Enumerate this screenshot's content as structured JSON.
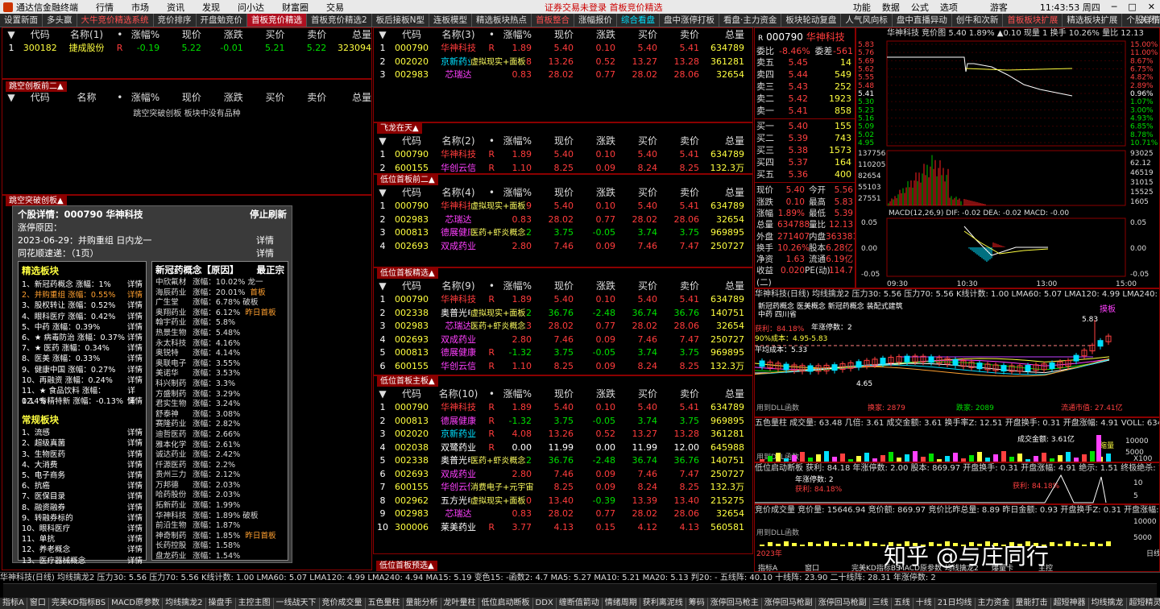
{
  "menubar": {
    "title": "通达信金融终端",
    "items": [
      "行情",
      "市场",
      "资讯",
      "发现",
      "问小达",
      "财富圈",
      "交易"
    ],
    "center": "证券交易未登录  首板竞价精选",
    "right": [
      "功能",
      "数据",
      "公式",
      "选项",
      "游客",
      "11:43:53 周四",
      "─",
      "□",
      "✕"
    ]
  },
  "tabs": [
    {
      "label": "设置新面",
      "k": ""
    },
    {
      "label": "多头赢",
      "k": ""
    },
    {
      "label": "大牛竞价精选系统",
      "k": "hot"
    },
    {
      "label": "竞价排序",
      "k": ""
    },
    {
      "label": "开盘勉竞价",
      "k": ""
    },
    {
      "label": "首板竞价精选",
      "k": "act"
    },
    {
      "label": "首板竞价精选2",
      "k": ""
    },
    {
      "label": "板后接板N型",
      "k": ""
    },
    {
      "label": "连板模型",
      "k": ""
    },
    {
      "label": "精选板块热点",
      "k": ""
    },
    {
      "label": "首板整合",
      "k": "hot"
    },
    {
      "label": "涨幅报价",
      "k": ""
    },
    {
      "label": "综合看盘",
      "k": "cy"
    },
    {
      "label": "盘中涨停打板",
      "k": ""
    },
    {
      "label": "看盘·主力资金",
      "k": ""
    },
    {
      "label": "板块轮动复盘",
      "k": ""
    },
    {
      "label": "人气风向标",
      "k": ""
    },
    {
      "label": "盘中直播异动",
      "k": ""
    },
    {
      "label": "创牛和次新",
      "k": ""
    },
    {
      "label": "首板板块扩展",
      "k": "hot"
    },
    {
      "label": "精选板块扩展",
      "k": ""
    },
    {
      "label": "个股详情",
      "k": ""
    }
  ],
  "left_top": {
    "headers": [
      "▼",
      "代码",
      "名称(1)",
      "•",
      "涨幅%",
      "现价",
      "涨跌",
      "买价",
      "卖价",
      "总量"
    ],
    "rows": [
      [
        "1",
        "300182",
        "捷成股份",
        "R",
        "-0.19",
        "5.22",
        "-0.01",
        "5.21",
        "5.22",
        "323094"
      ]
    ]
  },
  "left_mid": {
    "badge": "跳空创板前二▲",
    "headers": [
      "▼",
      "代码",
      "名称",
      "•",
      "涨幅%",
      "现价",
      "涨跌",
      "买价",
      "卖价",
      "总量"
    ],
    "empty": "跳空突破创板 板块中没有品种"
  },
  "left_bottom_badge": "跳空突破创板▲",
  "detail": {
    "title": "个股详情：000790  华神科技",
    "refresh": "停止刷新",
    "reason": "涨停原因：",
    "date": "2023-06-29：并购重组  日内龙一",
    "detail": "详情",
    "speed": "同花顺速递：（1页）",
    "speed_detail": "详情"
  },
  "select": {
    "title": "精选板块",
    "items": [
      [
        "1、新冠药概念 涨幅：1%",
        "详情"
      ],
      [
        "2、并购重组 涨幅：0.55%",
        "详情"
      ],
      [
        "3、股权转让 涨幅：0.52%",
        "详情"
      ],
      [
        "4、眼科医疗 涨幅：0.42%",
        "详情"
      ],
      [
        "5、中药 涨幅：0.39%",
        "详情"
      ],
      [
        "6、★ 病毒防治 涨幅：0.37%",
        "详情"
      ],
      [
        "7、★ 医药 涨幅：0.34%",
        "详情"
      ],
      [
        "8、医美 涨幅：0.33%",
        "详情"
      ],
      [
        "9、健康中国 涨幅：0.27%",
        "详情"
      ],
      [
        "10、再融资 涨幅：0.24%",
        "详情"
      ],
      [
        "11、★ 食品饮料 涨幅：0.14%",
        "详情"
      ],
      [
        "12、专精特新 涨幅：-0.13%",
        "详情"
      ]
    ],
    "normal_title": "常规板块",
    "normal": [
      [
        "1、流感",
        "详情"
      ],
      [
        "2、超级真菌",
        "详情"
      ],
      [
        "3、生物医药",
        "详情"
      ],
      [
        "4、大消费",
        "详情"
      ],
      [
        "5、电子商务",
        "详情"
      ],
      [
        "6、抗癌",
        "详情"
      ],
      [
        "7、医保目录",
        "详情"
      ],
      [
        "8、融资融券",
        "详情"
      ],
      [
        "9、转融券标的",
        "详情"
      ],
      [
        "10、眼科医疗",
        "详情"
      ],
      [
        "11、单抗",
        "详情"
      ],
      [
        "12、养老概念",
        "详情"
      ],
      [
        "13、医疗器械概念",
        "详情"
      ]
    ]
  },
  "concept": {
    "title": "新冠药概念【原因】",
    "lead": "最正宗",
    "rows": [
      [
        "中欣氟材",
        "涨幅：10.02% 龙一"
      ],
      [
        "海辰药业",
        "涨幅：20.01%",
        "首板"
      ],
      [
        "广生堂",
        "涨幅：6.78% 破板"
      ],
      [
        "奥翔药业",
        "涨幅：6.12%",
        "昨日首板"
      ],
      [
        "翰宇药业",
        "涨幅：5.8%"
      ],
      [
        "热景生物",
        "涨幅：5.48%"
      ],
      [
        "永太科技",
        "涨幅：4.16%"
      ],
      [
        "奥锐特",
        "涨幅：4.14%"
      ],
      [
        "奥联电子",
        "涨幅：3.55%"
      ],
      [
        "美诺华",
        "涨幅：3.53%"
      ],
      [
        "科兴制药",
        "涨幅：3.3%"
      ],
      [
        "方盛制药",
        "涨幅：3.29%"
      ],
      [
        "君实生物",
        "涨幅：3.24%"
      ],
      [
        "舒泰神",
        "涨幅：3.08%"
      ],
      [
        "赛隆药业",
        "涨幅：2.82%"
      ],
      [
        "迪哲医药",
        "涨幅：2.66%"
      ],
      [
        "雅本化学",
        "涨幅：2.61%"
      ],
      [
        "诚达药业",
        "涨幅：2.42%"
      ],
      [
        "仟源医药",
        "涨幅：2.2%"
      ],
      [
        "贵州三力",
        "涨幅：2.12%"
      ],
      [
        "万邦德",
        "涨幅：2.03%"
      ],
      [
        "哈药股份",
        "涨幅：2.03%"
      ],
      [
        "拓新药业",
        "涨幅：1.99%"
      ],
      [
        "华神科技",
        "涨幅：1.89% 破板"
      ],
      [
        "前沿生物",
        "涨幅：1.87%"
      ],
      [
        "神奇制药",
        "涨幅：1.85%",
        "昨日首板"
      ],
      [
        "长药控股",
        "涨幅：1.58%"
      ],
      [
        "盘龙药业",
        "涨幅：1.54%"
      ]
    ]
  },
  "mid_headers": [
    "▼",
    "代码",
    "名称",
    "•",
    "涨幅%",
    "现价",
    "涨跌",
    "买价",
    "卖价",
    "总量"
  ],
  "mid_panels": [
    {
      "badge": "",
      "hname": "名称(3)",
      "rows": [
        [
          "1",
          "000790",
          "华神科技",
          "R",
          "1.89",
          "5.40",
          "0.10",
          "5.40",
          "5.41",
          "634789",
          "r"
        ],
        [
          "2",
          "002020",
          "京新药业",
          "R",
          "4.08",
          "13.26",
          "0.52",
          "13.27",
          "13.28",
          "361281",
          "b"
        ],
        [
          "3",
          "002983",
          "芯瑞达",
          "",
          "0.83",
          "28.02",
          "0.77",
          "28.02",
          "28.06",
          "32654",
          "m"
        ]
      ],
      "notes": [
        [
          "虚拟现实+面板",
          2
        ]
      ]
    },
    {
      "badge": "飞龙在天▲",
      "hname": "名称(2)",
      "rows": [
        [
          "1",
          "000790",
          "华神科技",
          "R",
          "1.89",
          "5.40",
          "0.10",
          "5.40",
          "5.41",
          "634789",
          "r"
        ],
        [
          "2",
          "600155",
          "华创云信",
          "R",
          "1.10",
          "8.25",
          "0.09",
          "8.24",
          "8.25",
          "132.3万",
          "m"
        ]
      ],
      "notes": []
    },
    {
      "badge": "低位首板前二▲",
      "hname": "名称(4)",
      "rows": [
        [
          "1",
          "000790",
          "华神科技",
          "R",
          "1.89",
          "5.40",
          "0.10",
          "5.40",
          "5.41",
          "634789",
          "r"
        ],
        [
          "2",
          "002983",
          "芯瑞达",
          "",
          "0.83",
          "28.02",
          "0.77",
          "28.02",
          "28.06",
          "32654",
          "m"
        ],
        [
          "3",
          "000813",
          "德展健康",
          "R",
          "-1.32",
          "3.75",
          "-0.05",
          "3.74",
          "3.75",
          "969895",
          "m"
        ],
        [
          "4",
          "002693",
          "双成药业",
          "",
          "2.80",
          "7.46",
          "0.09",
          "7.46",
          "7.47",
          "250727",
          "m"
        ]
      ],
      "notes": [
        [
          "虚拟现实+面板",
          1
        ],
        [
          "医药+虾炎概念",
          3
        ]
      ]
    },
    {
      "badge": "低位首板精选▲",
      "hname": "名称(9)",
      "rows": [
        [
          "1",
          "000790",
          "华神科技",
          "R",
          "1.89",
          "5.40",
          "0.10",
          "5.40",
          "5.41",
          "634789",
          "r"
        ],
        [
          "2",
          "002338",
          "奥普光电",
          "R",
          "-6.32",
          "36.76",
          "-2.48",
          "36.74",
          "36.76",
          "140751",
          "w"
        ],
        [
          "3",
          "002983",
          "芯瑞达",
          "",
          "0.83",
          "28.02",
          "0.77",
          "28.02",
          "28.06",
          "32654",
          "m"
        ],
        [
          "4",
          "002693",
          "双成药业",
          "",
          "2.80",
          "7.46",
          "0.09",
          "7.46",
          "7.47",
          "250727",
          "m"
        ],
        [
          "5",
          "000813",
          "德展健康",
          "R",
          "-1.32",
          "3.75",
          "-0.05",
          "3.74",
          "3.75",
          "969895",
          "m"
        ],
        [
          "6",
          "600155",
          "华创云信",
          "R",
          "1.10",
          "8.25",
          "0.09",
          "8.24",
          "8.25",
          "132.3万",
          "m"
        ]
      ],
      "notes": [
        [
          "虚拟现实+面板",
          2
        ],
        [
          "医药+虾炎概念",
          3
        ]
      ]
    },
    {
      "badge": "低位首板主板▲",
      "hname": "名称(10)",
      "rows": [
        [
          "1",
          "000790",
          "华神科技",
          "R",
          "1.89",
          "5.40",
          "0.10",
          "5.40",
          "5.41",
          "634789",
          "r"
        ],
        [
          "2",
          "000813",
          "德展健康",
          "R",
          "-1.32",
          "3.75",
          "-0.05",
          "3.74",
          "3.75",
          "969895",
          "m"
        ],
        [
          "3",
          "002020",
          "京新药业",
          "R",
          "4.08",
          "13.26",
          "0.52",
          "13.27",
          "13.28",
          "361281",
          "b"
        ],
        [
          "4",
          "002038",
          "双鹭药业",
          "R",
          "0.00",
          "11.99",
          "0.00",
          "11.99",
          "12.00",
          "645988",
          "w"
        ],
        [
          "5",
          "002338",
          "奥普光电",
          "R",
          "-6.32",
          "36.76",
          "-2.48",
          "36.74",
          "36.76",
          "140751",
          "w"
        ],
        [
          "6",
          "002693",
          "双成药业",
          "",
          "2.80",
          "7.46",
          "0.09",
          "7.46",
          "7.47",
          "250727",
          "m"
        ],
        [
          "7",
          "600155",
          "华创云信",
          "R",
          "1.10",
          "8.25",
          "0.09",
          "8.24",
          "8.25",
          "132.3万",
          "m"
        ],
        [
          "8",
          "002962",
          "五方光电",
          "",
          "5.10",
          "13.40",
          "-0.39",
          "13.39",
          "13.40",
          "215275",
          "w"
        ],
        [
          "9",
          "002983",
          "芯瑞达",
          "",
          "0.83",
          "28.02",
          "0.77",
          "28.02",
          "28.06",
          "32654",
          "m"
        ],
        [
          "10",
          "300006",
          "莱美药业",
          "R",
          "3.77",
          "4.13",
          "0.15",
          "4.12",
          "4.13",
          "560581",
          "w"
        ]
      ],
      "notes": [
        [
          "医药+虾炎概念",
          5
        ],
        [
          "消费电子+元宇宙",
          7
        ],
        [
          "虚拟现实+面板",
          8
        ]
      ]
    }
  ],
  "mid_bottom_badge": "低位首板预选▲",
  "quote": {
    "code": "000790",
    "name": "华神科技",
    "weibi": [
      "委比",
      "-8.46%",
      "委差",
      "-561"
    ],
    "sells": [
      [
        "卖五",
        "5.45",
        "14"
      ],
      [
        "卖四",
        "5.44",
        "549"
      ],
      [
        "卖三",
        "5.43",
        "252"
      ],
      [
        "卖二",
        "5.42",
        "1923"
      ],
      [
        "卖一",
        "5.41",
        "858"
      ]
    ],
    "buys": [
      [
        "买一",
        "5.40",
        "155"
      ],
      [
        "买二",
        "5.39",
        "743"
      ],
      [
        "买三",
        "5.38",
        "1573"
      ],
      [
        "买四",
        "5.37",
        "164"
      ],
      [
        "买五",
        "5.36",
        "400"
      ]
    ],
    "stats": [
      [
        "现价",
        "5.40",
        "今开",
        "5.56"
      ],
      [
        "涨跌",
        "0.10",
        "最高",
        "5.83"
      ],
      [
        "涨幅",
        "1.89%",
        "最低",
        "5.39"
      ],
      [
        "总量",
        "634788",
        "量比",
        "12.13"
      ],
      [
        "外盘",
        "271407",
        "内盘",
        "363381"
      ],
      [
        "换手",
        "10.26%",
        "股本",
        "6.28亿"
      ],
      [
        "净资",
        "1.63",
        "流通",
        "6.19亿"
      ],
      [
        "收益(二)",
        "0.020",
        "PE(动)",
        "114.7"
      ]
    ]
  },
  "intraday": {
    "title": "华神科技  竞价图 5.40  1.89%  ▲0.10  现量 1  换手 10.26%  量比 12.13",
    "left": [
      "5.83",
      "5.76",
      "5.69",
      "5.62",
      "5.55",
      "5.48",
      "5.41",
      "5.30",
      "5.23",
      "5.16",
      "5.09",
      "5.02",
      "4.95"
    ],
    "right": [
      "15.00%",
      "11.00%",
      "8.67%",
      "6.75%",
      "4.82%",
      "2.89%",
      "0.96%",
      "1.07%",
      "3.00%",
      "4.93%",
      "6.85%",
      "8.78%",
      "10.71%"
    ],
    "vol_left": [
      "137756",
      "110205",
      "82654",
      "55103",
      "27551"
    ],
    "vol_right": [
      "93025",
      "62.12",
      "46519",
      "31015",
      "15525",
      "1605"
    ],
    "macd": "MACD(12,26,9)  DIF: -0.02  DEA: -0.02  MACD: -0.00",
    "macd_left": [
      "0.05",
      "0.00",
      "-0.05"
    ],
    "macd_right": [
      "0.05",
      "0.00",
      "-0.05"
    ],
    "times": [
      "09:30",
      "10:30",
      "13:00",
      "15:00"
    ]
  },
  "kline": {
    "title": "华神科技(日线)  均线擒龙2  压力30: 5.56  压力70: 5.56  K线计数: 1.00  LMA60: 5.07  LMA120: 4.99  LMA240: 4.94",
    "hi": "5.83",
    "lo": "4.65",
    "notes": [
      "获利：84.18%",
      "年涨停数：2",
      "平均成本：5.33",
      "90%成本：4.95-5.83",
      "新冠药概念 医美概念 新冠药概念 装配式建筑",
      "中药 四川省",
      "1.3.79"
    ],
    "foot": "用到DLL函数",
    "bottom": [
      "换家: 2879",
      "跌家: 2089",
      "流通市值: 27.41亿"
    ],
    "mark": "摸板"
  },
  "ind1": {
    "title": "五色量柱  成交量: 63.48  几倍: 3.61  成交金额: 3.61  换手率Z: 12.51  开盘换手: 0.31  开盘涨幅: 4.91  VOLL: 634788",
    "note": "成交金额: 3.61亿",
    "axis": [
      "10000",
      "5000"
    ],
    "foot": "用到DLL函数",
    "right": "X100",
    "mark": "缩量"
  },
  "ind2": {
    "title": "低位启动断板  获利: 84.18  年涨停数: 2.00  股本: 869.97  开盘换手: 0.31  开盘涨幅: 4.91  绝示: 1.51  终极绝杀: 1",
    "notes": [
      "年涨停数: 2",
      "获利: 84.18%",
      "获利: 84.18%"
    ],
    "axis": [
      "10",
      "5"
    ]
  },
  "ind3": {
    "title": "竞价成交量  竞价量: 15646.94  竞价额: 869.97  竞价比昨总量: 8.89  昨日金额: 0.93  开盘换手Z: 0.31  开盘涨幅: 4.9",
    "axis": [
      "10000",
      "5000"
    ],
    "foot": "用到DLL函数",
    "year": "2023年",
    "tabs": [
      "指标A",
      "窗口",
      "完美KD指标BS",
      "MACD原参数",
      "均线擒龙2",
      "爆量卡",
      "主控"
    ],
    "ri": "日线",
    "watermark": "知乎 @与庄同行"
  },
  "bottom_bar": "华神科技(日线)  均线擒龙2  压力30: 5.56  压力70: 5.56  K线计数: 1.00  LMA60: 5.07  LMA120: 4.99  LMA240: 4.94  MA15: 5.19  变色15: -函数2: 4.7  MA5: 5.27  MA10: 5.21  MA20: 5.13  判20: -  五线阵: 40.10  十线阵: 23.90  二十线阵: 28.31  年涨停数: 2",
  "bottom_tabs": [
    "指标A",
    "窗口",
    "完美KD指标BS",
    "MACD原参数",
    "均线擒龙2",
    "操盘手",
    "主控主图",
    "一线战天下",
    "竞价成交量",
    "五色量柱",
    "量能分析",
    "龙叶量柱",
    "低位启动断板",
    "DDX",
    "缠断值箭动",
    "情绪周期",
    "获利离泥线",
    "筹码",
    "涨停回马枪主",
    "涨停回马枪副",
    "涨停回马枪副",
    "三线",
    "五线",
    "十线",
    "21日均线",
    "主力资金",
    "量能打击",
    "超短神器",
    "均线擒龙",
    "超短精灵",
    "主力控盘",
    "主力护盘",
    "日线"
  ]
}
